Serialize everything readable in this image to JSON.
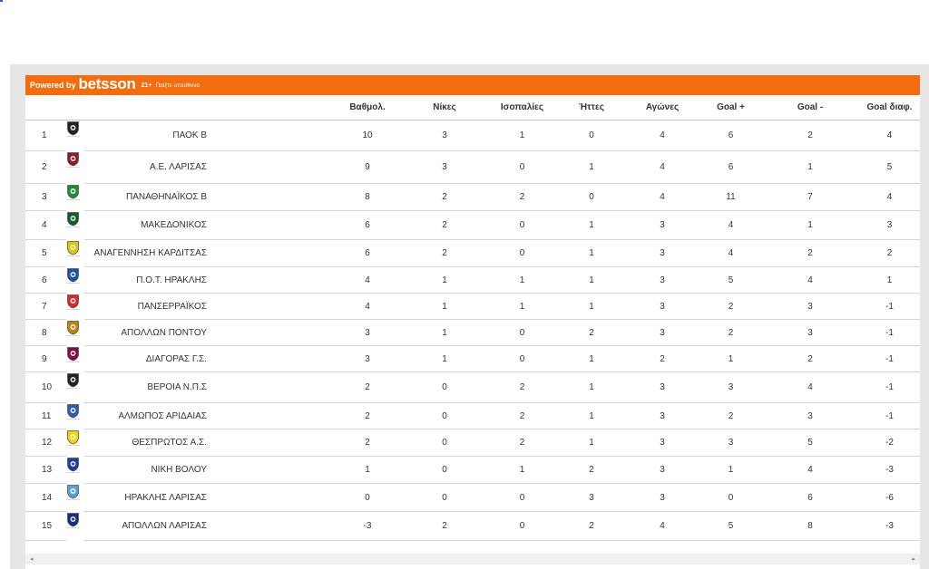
{
  "brand": {
    "powered_by": "Powered by",
    "logo": "betsson",
    "age": "21+",
    "responsible": "Παίξτε υπεύθυνα",
    "color": "#f36c0d"
  },
  "headers": [
    "Βαθμολ.",
    "Νίκες",
    "Ισοπαλίες",
    "Ήττες",
    "Αγώνες",
    "Goal +",
    "Goal -",
    "Goal διαφ."
  ],
  "rows": [
    {
      "pos": "1",
      "team": "ΠΑΟΚ Β",
      "points": "10",
      "wins": "3",
      "draws": "1",
      "losses": "0",
      "played": "4",
      "gf": "6",
      "ga": "2",
      "gd": "4",
      "crest_icon": "paok-crest-icon",
      "crest_color": "#222222"
    },
    {
      "pos": "2",
      "team": "Α.Ε. ΛΑΡΙΣΑΣ",
      "points": "9",
      "wins": "3",
      "draws": "0",
      "losses": "1",
      "played": "4",
      "gf": "6",
      "ga": "1",
      "gd": "5",
      "crest_icon": "ae-larisas-crest-icon",
      "crest_color": "#8b1a2b"
    },
    {
      "pos": "3",
      "team": "ΠΑΝΑΘΗΝΑΪΚΟΣ Β",
      "points": "8",
      "wins": "2",
      "draws": "2",
      "losses": "0",
      "played": "4",
      "gf": "11",
      "ga": "7",
      "gd": "4",
      "crest_icon": "panathinaikos-crest-icon",
      "crest_color": "#1f8a3c"
    },
    {
      "pos": "4",
      "team": "ΜΑΚΕΔΟΝΙΚΟΣ",
      "points": "6",
      "wins": "2",
      "draws": "0",
      "losses": "1",
      "played": "3",
      "gf": "4",
      "ga": "1",
      "gd": "3",
      "crest_icon": "makedonikos-crest-icon",
      "crest_color": "#145a2a"
    },
    {
      "pos": "5",
      "team": "ΑΝΑΓΕΝΝΗΣΗ ΚΑΡΔΙΤΣΑΣ",
      "points": "6",
      "wins": "2",
      "draws": "0",
      "losses": "1",
      "played": "3",
      "gf": "4",
      "ga": "2",
      "gd": "2",
      "crest_icon": "anagennisi-crest-icon",
      "crest_color": "#e0c20a"
    },
    {
      "pos": "6",
      "team": "Π.Ο.Τ. ΗΡΑΚΛΗΣ",
      "points": "4",
      "wins": "1",
      "draws": "1",
      "losses": "1",
      "played": "3",
      "gf": "5",
      "ga": "4",
      "gd": "1",
      "crest_icon": "pot-iraklis-crest-icon",
      "crest_color": "#1e4fa0"
    },
    {
      "pos": "7",
      "team": "ΠΑΝΣΕΡΡΑΪΚΟΣ",
      "points": "4",
      "wins": "1",
      "draws": "1",
      "losses": "1",
      "played": "3",
      "gf": "2",
      "ga": "3",
      "gd": "-1",
      "crest_icon": "panserraikos-crest-icon",
      "crest_color": "#d62828"
    },
    {
      "pos": "8",
      "team": "ΑΠΟΛΛΩΝ ΠΟΝΤΟΥ",
      "points": "3",
      "wins": "1",
      "draws": "0",
      "losses": "2",
      "played": "3",
      "gf": "2",
      "ga": "3",
      "gd": "-1",
      "crest_icon": "apollon-pontou-crest-icon",
      "crest_color": "#b8860b"
    },
    {
      "pos": "9",
      "team": "ΔΙΑΓΟΡΑΣ Γ.Σ.",
      "points": "3",
      "wins": "1",
      "draws": "0",
      "losses": "1",
      "played": "2",
      "gf": "1",
      "ga": "2",
      "gd": "-1",
      "crest_icon": "diagoras-crest-icon",
      "crest_color": "#7a1040"
    },
    {
      "pos": "10",
      "team": "ΒΕΡΟΙΑ Ν.Π.Σ",
      "points": "2",
      "wins": "0",
      "draws": "2",
      "losses": "1",
      "played": "3",
      "gf": "3",
      "ga": "4",
      "gd": "-1",
      "crest_icon": "veria-crest-icon",
      "crest_color": "#222222"
    },
    {
      "pos": "11",
      "team": "ΑΛΜΩΠΟΣ ΑΡΙΔΑΙΑΣ",
      "points": "2",
      "wins": "0",
      "draws": "2",
      "losses": "1",
      "played": "3",
      "gf": "2",
      "ga": "3",
      "gd": "-1",
      "crest_icon": "almopos-crest-icon",
      "crest_color": "#2a5fa8"
    },
    {
      "pos": "12",
      "team": "ΘΕΣΠΡΩΤΟΣ Α.Σ.",
      "points": "2",
      "wins": "0",
      "draws": "2",
      "losses": "1",
      "played": "3",
      "gf": "3",
      "ga": "5",
      "gd": "-2",
      "crest_icon": "thesprotos-crest-icon",
      "crest_color": "#f2d20a"
    },
    {
      "pos": "13",
      "team": "ΝΙΚΗ ΒΟΛΟΥ",
      "points": "1",
      "wins": "0",
      "draws": "1",
      "losses": "2",
      "played": "3",
      "gf": "1",
      "ga": "4",
      "gd": "-3",
      "crest_icon": "niki-volou-crest-icon",
      "crest_color": "#1a3f9a"
    },
    {
      "pos": "14",
      "team": "ΗΡΑΚΛΗΣ ΛΑΡΙΣΑΣ",
      "points": "0",
      "wins": "0",
      "draws": "0",
      "losses": "3",
      "played": "3",
      "gf": "0",
      "ga": "6",
      "gd": "-6",
      "crest_icon": "iraklis-larisas-crest-icon",
      "crest_color": "#5aa0d8"
    },
    {
      "pos": "15",
      "team": "ΑΠΟΛΛΩΝ ΛΑΡΙΣΑΣ",
      "points": "-3",
      "wins": "2",
      "draws": "0",
      "losses": "2",
      "played": "4",
      "gf": "5",
      "ga": "8",
      "gd": "-3",
      "crest_icon": "apollon-larisas-crest-icon",
      "crest_color": "#1a2f7a"
    }
  ],
  "scroll": {
    "left_arrow": "◂",
    "right_arrow": "▸"
  }
}
